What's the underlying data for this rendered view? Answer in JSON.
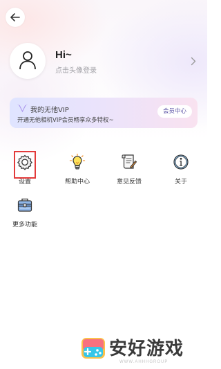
{
  "profile": {
    "greeting": "Hi~",
    "login_hint": "点击头像登录"
  },
  "vip": {
    "title": "我的无他VIP",
    "subtitle": "开通无他相机VIP会员畅享众多特权~",
    "button_label": "会员中心"
  },
  "menu": {
    "items": [
      {
        "label": "设置",
        "icon": "gear-icon"
      },
      {
        "label": "帮助中心",
        "icon": "lightbulb-icon"
      },
      {
        "label": "意见反馈",
        "icon": "feedback-scroll-icon"
      },
      {
        "label": "关于",
        "icon": "info-icon"
      },
      {
        "label": "更多功能",
        "icon": "toolbox-icon"
      }
    ]
  },
  "watermark": {
    "text": "安好游戏",
    "url": "WWW.AHHHGROUP"
  },
  "colors": {
    "highlight": "#e33b3b",
    "vip_button_text": "#5f57a8",
    "accent_orange": "#f59a3c"
  }
}
